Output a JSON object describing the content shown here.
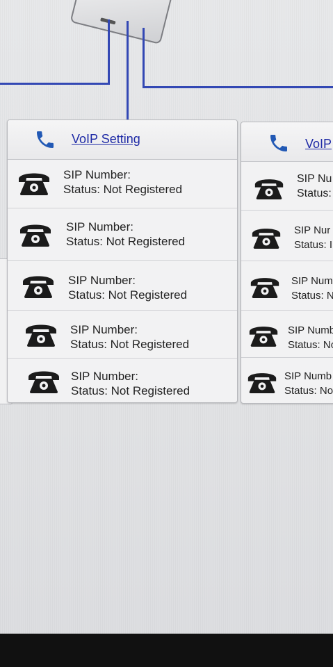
{
  "panels": [
    {
      "title": "VoIP Setting",
      "header_icon": "handset-icon",
      "rows": [
        {
          "sip_label": "SIP Number:",
          "status": "Status: Not Registered",
          "icon": "phone-icon"
        },
        {
          "sip_label": "SIP Number:",
          "status": "Status: Not Registered",
          "icon": "phone-icon"
        },
        {
          "sip_label": "SIP Number:",
          "status": "Status: Not Registered",
          "icon": "phone-icon"
        },
        {
          "sip_label": "SIP Number:",
          "status": "Status: Not Registered",
          "icon": "phone-icon"
        },
        {
          "sip_label": "SIP Number:",
          "status": "Status: Not Registered",
          "icon": "phone-icon"
        }
      ]
    },
    {
      "title": "VoIP",
      "header_icon": "handset-icon",
      "rows": [
        {
          "sip_label": "SIP Nu",
          "status": "Status:",
          "icon": "phone-icon"
        },
        {
          "sip_label": "SIP Nur",
          "status": "Status: I",
          "icon": "phone-icon"
        },
        {
          "sip_label": "SIP Num",
          "status": "Status: N",
          "icon": "phone-icon"
        },
        {
          "sip_label": "SIP Numb",
          "status": "Status: No",
          "icon": "phone-icon"
        },
        {
          "sip_label": "SIP Numb",
          "status": "Status: No",
          "icon": "phone-icon"
        }
      ]
    }
  ],
  "colors": {
    "link": "#1e2aa6",
    "wire": "#3348b4",
    "icon_blue": "#2259b5",
    "phone_black": "#1b1b1b"
  }
}
